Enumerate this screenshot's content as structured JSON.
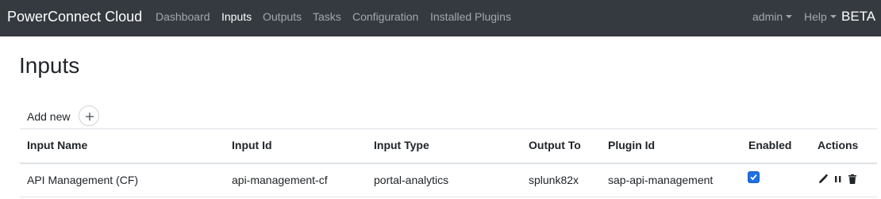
{
  "navbar": {
    "brand": "PowerConnect Cloud",
    "items": [
      {
        "label": "Dashboard"
      },
      {
        "label": "Inputs"
      },
      {
        "label": "Outputs"
      },
      {
        "label": "Tasks"
      },
      {
        "label": "Configuration"
      },
      {
        "label": "Installed Plugins"
      }
    ],
    "active_item": "Inputs",
    "user_menu": "admin",
    "help_menu": "Help",
    "badge": "BETA"
  },
  "page": {
    "title": "Inputs",
    "add_new_label": "Add new",
    "add_icon": "plus-icon"
  },
  "table": {
    "columns": [
      "Input Name",
      "Input Id",
      "Input Type",
      "Output To",
      "Plugin Id",
      "Enabled",
      "Actions"
    ],
    "rows": [
      {
        "input_name": "API Management (CF)",
        "input_id": "api-management-cf",
        "input_type": "portal-analytics",
        "output_to": "splunk82x",
        "plugin_id": "sap-api-management",
        "enabled": true,
        "actions": [
          "edit-icon",
          "pause-icon",
          "delete-icon"
        ]
      }
    ]
  },
  "colors": {
    "navbar_bg": "#343a40",
    "checkbox_accent": "#1f6fe5"
  }
}
